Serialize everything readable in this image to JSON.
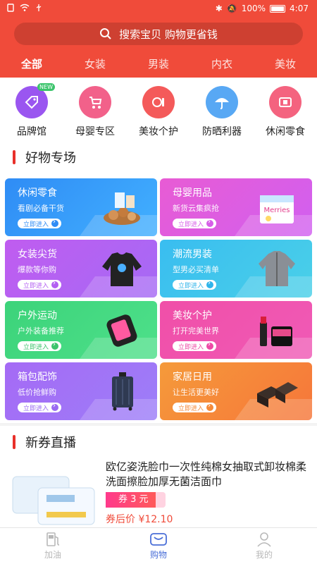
{
  "status_bar": {
    "battery": "100%",
    "time": "4:07"
  },
  "search": {
    "placeholder": "搜索宝贝  购物更省钱"
  },
  "tabs": [
    {
      "label": "全部",
      "active": true
    },
    {
      "label": "女装"
    },
    {
      "label": "男装"
    },
    {
      "label": "内衣"
    },
    {
      "label": "美妆"
    }
  ],
  "categories": [
    {
      "label": "品牌馆",
      "icon": "tag-icon",
      "color": "#9a56f0",
      "badge": "NEW"
    },
    {
      "label": "母婴专区",
      "icon": "stroller-icon",
      "color": "#f2618a"
    },
    {
      "label": "美妆个护",
      "icon": "lipstick-icon",
      "color": "#f45a5a"
    },
    {
      "label": "防晒利器",
      "icon": "umbrella-icon",
      "color": "#58a8f4"
    },
    {
      "label": "休闲零食",
      "icon": "snack-icon",
      "color": "#f4637f"
    }
  ],
  "sections": {
    "featured": "好物专场",
    "coupons": "新券直播"
  },
  "promo_cards": [
    {
      "title": "休闲零食",
      "subtitle": "看剧必备干货",
      "button": "立即进入",
      "from": "#2f8cf5",
      "to": "#42b0ff",
      "accent": "#2f8cf5"
    },
    {
      "title": "母婴用品",
      "subtitle": "新货云集疯抢",
      "button": "立即进入",
      "from": "#e85bd4",
      "to": "#d160f0",
      "accent": "#d75ee8"
    },
    {
      "title": "女装尖货",
      "subtitle": "爆款等你购",
      "button": "立即进入",
      "from": "#c05cf0",
      "to": "#a56af5",
      "accent": "#b35ff2"
    },
    {
      "title": "潮流男装",
      "subtitle": "型男必买清单",
      "button": "立即进入",
      "from": "#39bdf0",
      "to": "#4ad0e8",
      "accent": "#2fb4ea"
    },
    {
      "title": "户外运动",
      "subtitle": "户外装备推荐",
      "button": "立即进入",
      "from": "#3cd37a",
      "to": "#4ee08a",
      "accent": "#3cc46c"
    },
    {
      "title": "美妆个护",
      "subtitle": "打开完美世界",
      "button": "立即进入",
      "from": "#f04fa8",
      "to": "#f05ab6",
      "accent": "#ee4aa6"
    },
    {
      "title": "箱包配饰",
      "subtitle": "低价抢鲜购",
      "button": "立即进入",
      "from": "#a56af5",
      "to": "#9d7ef8",
      "accent": "#9a6af2"
    },
    {
      "title": "家居日用",
      "subtitle": "让生活更美好",
      "button": "立即进入",
      "from": "#f59a3a",
      "to": "#f6763a",
      "accent": "#f58a3a"
    }
  ],
  "product": {
    "title": "欧亿姿洗脸巾一次性纯棉女抽取式卸妆棉柔洗面擦脸加厚无菌洁面巾",
    "coupon": "券 3 元",
    "after_price": "券后价 ¥12.10"
  },
  "bottom_nav": [
    {
      "label": "加油",
      "icon": "fuel-icon"
    },
    {
      "label": "购物",
      "icon": "shopping-icon",
      "active": true
    },
    {
      "label": "我的",
      "icon": "user-icon"
    }
  ]
}
